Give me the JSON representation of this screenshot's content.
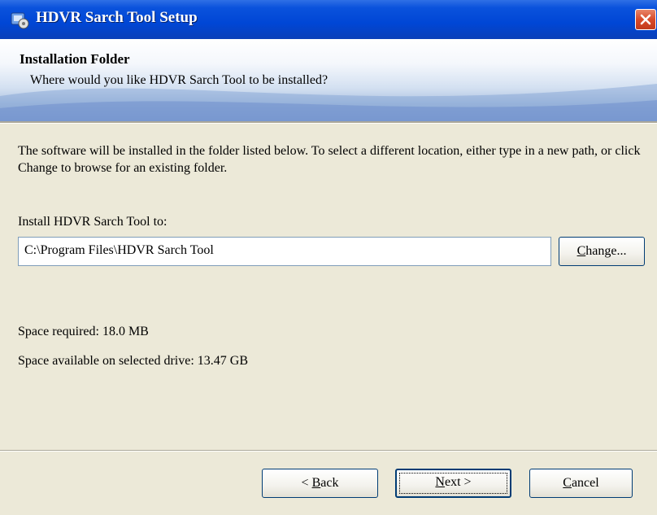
{
  "window": {
    "title": "HDVR Sarch Tool Setup",
    "icon": "installer-icon",
    "close_icon": "close-icon"
  },
  "banner": {
    "title": "Installation Folder",
    "subtitle": "Where would you like HDVR Sarch Tool to be installed?"
  },
  "body": {
    "description": "The software will be installed in the folder listed below. To select a different location, either type in a new path, or click Change to browse for an existing folder.",
    "install_label": "Install HDVR Sarch Tool to:",
    "install_path": "C:\\Program Files\\HDVR Sarch Tool",
    "change_button": {
      "mnemonic": "C",
      "rest": "hange..."
    },
    "space_required": "Space required: 18.0 MB",
    "space_available": "Space available on selected drive: 13.47 GB"
  },
  "footer": {
    "back_button": {
      "prefix": "< ",
      "mnemonic": "B",
      "rest": "ack"
    },
    "next_button": {
      "mnemonic": "N",
      "rest": "ext >"
    },
    "cancel_button": {
      "mnemonic": "C",
      "rest": "ancel"
    }
  },
  "colors": {
    "titlebar": "#0046d5",
    "dialog_background": "#ece9d8",
    "close_button": "#d84a2a"
  }
}
